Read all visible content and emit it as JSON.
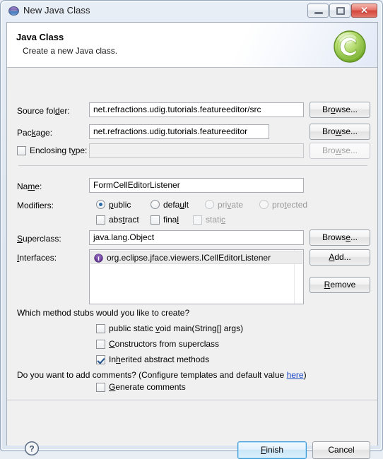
{
  "window": {
    "title": "New Java Class",
    "icon": "eclipse-globe-icon",
    "controls": {
      "minimize": "minimize-icon",
      "maximize": "restore-icon",
      "close": "✕"
    }
  },
  "header": {
    "title": "Java Class",
    "description": "Create a new Java class.",
    "icon": "java-class-green-c-icon"
  },
  "form": {
    "source_folder": {
      "label": "Source folder:",
      "value": "net.refractions.udig.tutorials.featureeditor/src",
      "button": "Browse...",
      "enabled": true
    },
    "package": {
      "label": "Package:",
      "value": "net.refractions.udig.tutorials.featureeditor",
      "button": "Browse...",
      "enabled": true
    },
    "enclosing_type": {
      "label": "Enclosing type:",
      "value": "",
      "button": "Browse...",
      "checked": false,
      "enabled": false
    },
    "name": {
      "label": "Name:",
      "value": "FormCellEditorListener"
    },
    "modifiers": {
      "label": "Modifiers:",
      "radios": [
        {
          "label": "public",
          "checked": true,
          "enabled": true
        },
        {
          "label": "default",
          "checked": false,
          "enabled": true
        },
        {
          "label": "private",
          "checked": false,
          "enabled": false
        },
        {
          "label": "protected",
          "checked": false,
          "enabled": false
        }
      ],
      "checkboxes": [
        {
          "label": "abstract",
          "checked": false,
          "enabled": true
        },
        {
          "label": "final",
          "checked": false,
          "enabled": true
        },
        {
          "label": "static",
          "checked": false,
          "enabled": false
        }
      ]
    },
    "superclass": {
      "label": "Superclass:",
      "value": "java.lang.Object",
      "button": "Browse..."
    },
    "interfaces": {
      "label": "Interfaces:",
      "items": [
        {
          "text": "org.eclipse.jface.viewers.ICellEditorListener",
          "icon": "interface-icon",
          "selected": true
        }
      ],
      "add_button": "Add...",
      "remove_button": "Remove"
    },
    "stubs": {
      "question": "Which method stubs would you like to create?",
      "options": [
        {
          "label": "public static void main(String[] args)",
          "checked": false
        },
        {
          "label": "Constructors from superclass",
          "checked": false
        },
        {
          "label": "Inherited abstract methods",
          "checked": true
        }
      ]
    },
    "comments": {
      "question_prefix": "Do you want to add comments? (Configure templates and default value ",
      "link": "here",
      "question_suffix": ")",
      "option": {
        "label": "Generate comments",
        "checked": false
      }
    }
  },
  "footer": {
    "help": "?",
    "finish": "Finish",
    "cancel": "Cancel"
  },
  "colors": {
    "accent": "#3c9ad6",
    "link": "#1a49c4",
    "dialog_bg": "#f0f0f0",
    "close_button": "#d4453b",
    "class_icon_green": "#8cc63f",
    "interface_icon_purple": "#6a3d9a"
  }
}
